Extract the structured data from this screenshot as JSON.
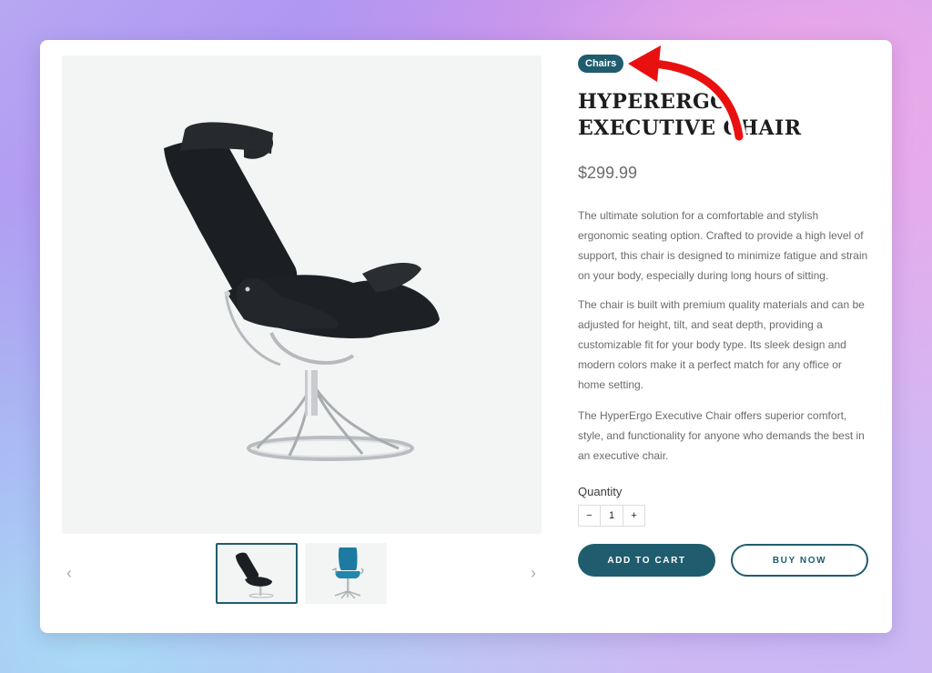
{
  "product": {
    "category": "Chairs",
    "title": "HYPERERGO EXECUTIVE CHAIR",
    "price": "$299.99",
    "description": [
      "The ultimate solution for a comfortable and stylish ergonomic seating option. Crafted to provide a high level of support, this chair is designed to minimize fatigue and strain on your body, especially during long hours of sitting.",
      "The chair is built with premium quality materials and can be adjusted for height, tilt, and seat depth, providing a customizable fit for your body type. Its sleek design and modern colors make it a perfect match for any office or home setting.",
      "The HyperErgo Executive Chair offers superior comfort, style, and functionality for anyone who demands the best in an executive chair."
    ]
  },
  "quantity": {
    "label": "Quantity",
    "minus": "−",
    "value": "1",
    "plus": "+"
  },
  "actions": {
    "add_to_cart": "ADD TO CART",
    "buy_now": "BUY NOW"
  },
  "gallery": {
    "prev_icon": "‹",
    "next_icon": "›",
    "selected_index": 0,
    "thumbnail_count": 2
  },
  "colors": {
    "accent": "#1f5d6e",
    "annotation_arrow": "#e8110f"
  }
}
